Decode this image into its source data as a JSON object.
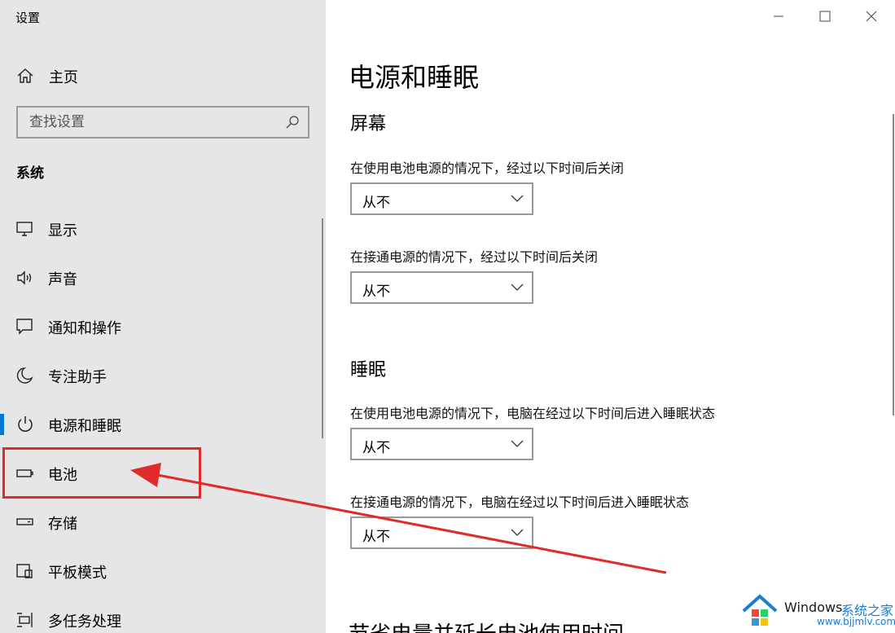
{
  "window": {
    "title": "设置"
  },
  "sidebar": {
    "home_label": "主页",
    "search_placeholder": "查找设置",
    "section_title": "系统",
    "items": [
      {
        "label": "显示",
        "icon": "monitor-icon"
      },
      {
        "label": "声音",
        "icon": "speaker-icon"
      },
      {
        "label": "通知和操作",
        "icon": "notification-icon"
      },
      {
        "label": "专注助手",
        "icon": "moon-icon"
      },
      {
        "label": "电源和睡眠",
        "icon": "power-icon",
        "active": true
      },
      {
        "label": "电池",
        "icon": "battery-icon",
        "highlighted": true
      },
      {
        "label": "存储",
        "icon": "storage-icon"
      },
      {
        "label": "平板模式",
        "icon": "tablet-icon"
      },
      {
        "label": "多任务处理",
        "icon": "multitask-icon"
      }
    ]
  },
  "main": {
    "title": "电源和睡眠",
    "screen": {
      "heading": "屏幕",
      "battery_label": "在使用电池电源的情况下，经过以下时间后关闭",
      "battery_value": "从不",
      "plugged_label": "在接通电源的情况下，经过以下时间后关闭",
      "plugged_value": "从不"
    },
    "sleep": {
      "heading": "睡眠",
      "battery_label": "在使用电池电源的情况下，电脑在经过以下时间后进入睡眠状态",
      "battery_value": "从不",
      "plugged_label": "在接通电源的情况下，电脑在经过以下时间后进入睡眠状态",
      "plugged_value": "从不"
    },
    "bottom_heading": "节省电量并延长电池使用时间"
  },
  "watermark": {
    "name": "Windows",
    "brand": "系统之家",
    "url": "www.bjjmlv.com"
  },
  "colors": {
    "accent": "#0078d7",
    "annotation": "#e02b2b",
    "sidebar_bg": "#e6e6e6"
  }
}
